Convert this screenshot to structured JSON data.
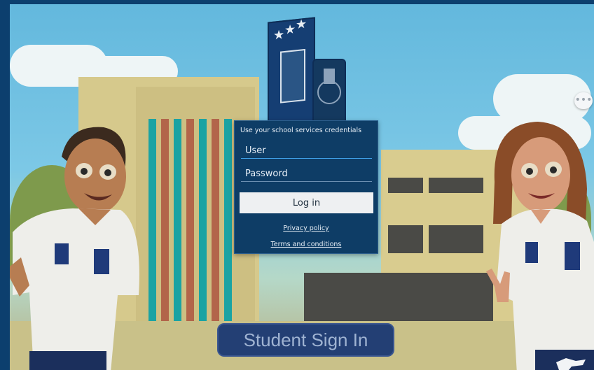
{
  "login": {
    "caption": "Use your school services credentials",
    "user_placeholder": "User",
    "password_placeholder": "Password",
    "login_label": "Log in",
    "privacy_label": "Privacy policy",
    "terms_label": "Terms and conditions"
  },
  "student_button": {
    "label": "Student Sign In"
  },
  "more_button": {
    "icon": "more-dots-icon",
    "label": "•••"
  },
  "colors": {
    "page_border": "#0c3f6e",
    "panel": "#0e3d66",
    "login_button": "#eef0f2",
    "student_button": "#233f74",
    "input_focus": "#3fa0e8"
  }
}
